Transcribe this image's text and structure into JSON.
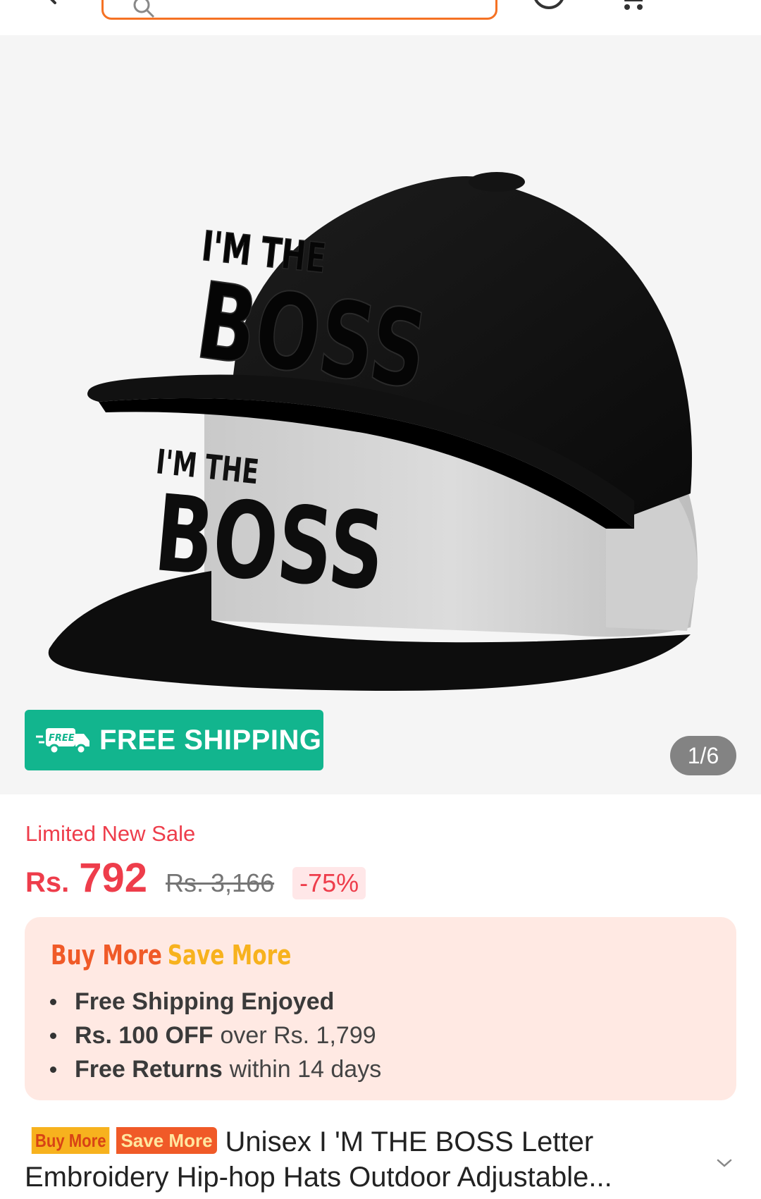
{
  "header": {
    "search_placeholder": ""
  },
  "gallery": {
    "badge_label": "FREE SHIPPING",
    "truck_badge_text": "FREE",
    "counter": "1/6",
    "cap_front_text_top": "I'M THE",
    "cap_front_text_main": "BOSS",
    "cap_back_text_top": "I'M THE",
    "cap_back_text_main": "BOSS"
  },
  "price": {
    "sale_tag": "Limited New Sale",
    "currency": "Rs.",
    "current": "792",
    "original": "Rs. 3,166",
    "discount": "-75%"
  },
  "promo": {
    "title_buy": "Buy More",
    "title_save": "Save More",
    "items": [
      {
        "strong": "Free Shipping Enjoyed",
        "rest": ""
      },
      {
        "strong": "Rs. 100 OFF",
        "rest": "over Rs. 1,799"
      },
      {
        "strong": "Free Returns",
        "rest": "within 14 days"
      }
    ]
  },
  "product": {
    "badge_buy": "Buy More",
    "badge_save": "Save More",
    "title": "Unisex I 'M THE BOSS Letter Embroidery Hip-hop Hats Outdoor Adjustable..."
  },
  "colors": {
    "accent": "#f57224",
    "price_red": "#ee3d4b",
    "shipping_green": "#12b58e",
    "promo_bg": "#ffe9e3"
  }
}
